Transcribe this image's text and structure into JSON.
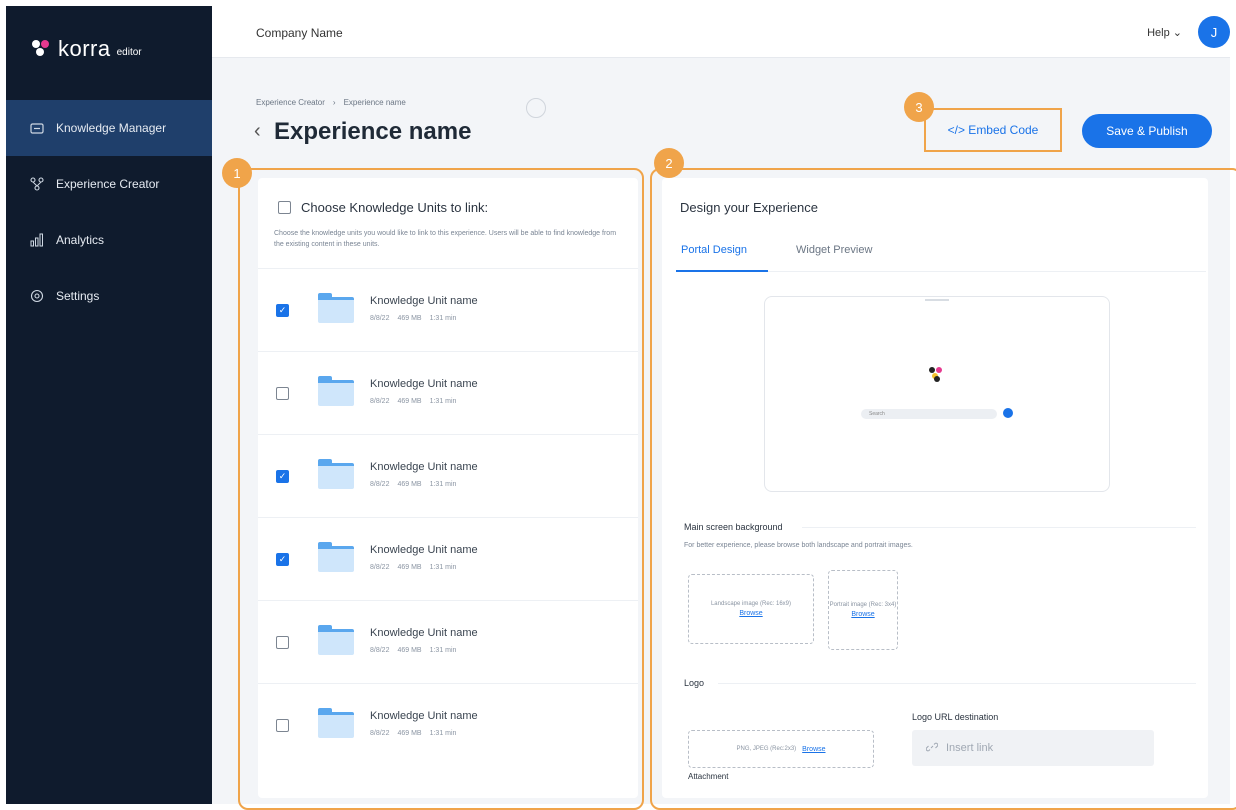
{
  "app": {
    "brand": "korra",
    "brand_sub": "editor"
  },
  "sidebar": {
    "items": [
      {
        "label": "Knowledge Manager",
        "icon": "folder-icon",
        "active": true
      },
      {
        "label": "Experience Creator",
        "icon": "nodes-icon",
        "active": false
      },
      {
        "label": "Analytics",
        "icon": "bar-chart-icon",
        "active": false
      },
      {
        "label": "Settings",
        "icon": "gear-icon",
        "active": false
      }
    ]
  },
  "topbar": {
    "company": "Company Name",
    "help": "Help ⌄",
    "avatar_initial": "J"
  },
  "header": {
    "breadcrumb": [
      "Experience Creator",
      "›",
      "Experience name"
    ],
    "title": "Experience name",
    "embed_label": "</> Embed Code",
    "publish_label": "Save & Publish"
  },
  "badges": {
    "one": "1",
    "two": "2",
    "three": "3"
  },
  "panel1": {
    "choose_label": "Choose Knowledge Units to link:",
    "description": "Choose the knowledge units you would like to link to this experience. Users will be able to find knowledge from the existing content in these units.",
    "units": [
      {
        "name": "Knowledge Unit name",
        "date": "8/8/22",
        "size": "469 MB",
        "duration": "1:31 min",
        "checked": true
      },
      {
        "name": "Knowledge Unit name",
        "date": "8/8/22",
        "size": "469 MB",
        "duration": "1:31 min",
        "checked": false
      },
      {
        "name": "Knowledge Unit name",
        "date": "8/8/22",
        "size": "469 MB",
        "duration": "1:31 min",
        "checked": true
      },
      {
        "name": "Knowledge Unit name",
        "date": "8/8/22",
        "size": "469 MB",
        "duration": "1:31 min",
        "checked": true
      },
      {
        "name": "Knowledge Unit name",
        "date": "8/8/22",
        "size": "469 MB",
        "duration": "1:31 min",
        "checked": false
      },
      {
        "name": "Knowledge Unit name",
        "date": "8/8/22",
        "size": "469 MB",
        "duration": "1:31 min",
        "checked": false
      }
    ]
  },
  "panel2": {
    "title": "Design your Experience",
    "tabs": [
      "Portal Design",
      "Widget Preview"
    ],
    "preview_search": "Search",
    "background_label": "Main screen background",
    "background_desc": "For better experience, please browse both landscape and portrait images.",
    "landscape_text": "Landscape image (Rec: 16x9)",
    "portrait_text": "Portrait image (Rec: 3x4)",
    "browse": "Browse",
    "logo_label": "Logo",
    "attachment_label": "Attachment",
    "attachment_text": "PNG, JPEG (Rec:2x3)",
    "logo_url_label": "Logo URL destination",
    "insert_link": "Insert link"
  },
  "colors": {
    "sidebar": "#0f1b2d",
    "accent": "#1a73e8",
    "highlight": "#f0a44a"
  }
}
